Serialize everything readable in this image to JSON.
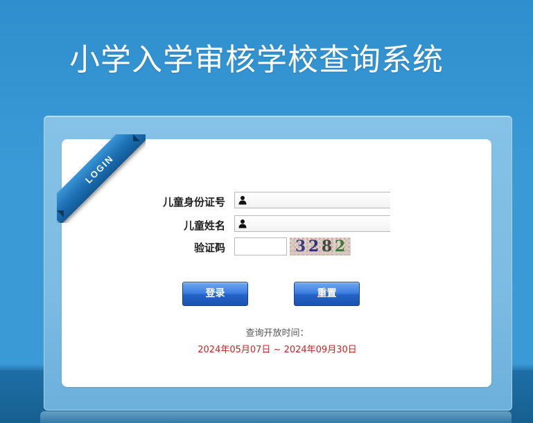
{
  "page": {
    "title": "小学入学审核学校查询系统"
  },
  "login_badge": "LOGIN",
  "form": {
    "id_label": "儿童身份证号",
    "name_label": "儿童姓名",
    "captcha_label": "验证码",
    "colon": ":",
    "id_value": "",
    "name_value": "",
    "captcha_value": "",
    "captcha_image_text": [
      "3",
      "2",
      "8",
      "2"
    ],
    "input_icon": "user-icon"
  },
  "buttons": {
    "login_label": "登录",
    "reset_label": "重置"
  },
  "schedule": {
    "label": "查询开放时间：",
    "dates": "2024年05月07日 ~ 2024年09月30日"
  },
  "colors": {
    "background": "#3a9ad6",
    "panel": "#86c2e6",
    "button": "#2463c8",
    "dates_text": "#d22020"
  }
}
